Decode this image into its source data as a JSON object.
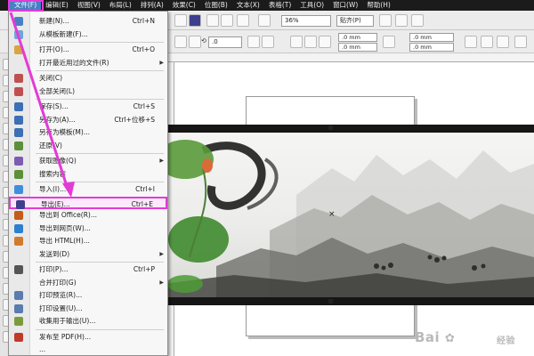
{
  "menubar": {
    "items": [
      {
        "label": "文件(F)",
        "active": true
      },
      {
        "label": "编辑(E)"
      },
      {
        "label": "视图(V)"
      },
      {
        "label": "布局(L)"
      },
      {
        "label": "排列(A)"
      },
      {
        "label": "效果(C)"
      },
      {
        "label": "位图(B)"
      },
      {
        "label": "文本(X)"
      },
      {
        "label": "表格(T)"
      },
      {
        "label": "工具(O)"
      },
      {
        "label": "窗口(W)"
      },
      {
        "label": "帮助(H)"
      }
    ]
  },
  "toolbar1": {
    "zoom_value": "36%",
    "snap_label": "贴齐(P)"
  },
  "toolbar2": {
    "rotation_value": ".0",
    "x_offset": ".0 mm",
    "y_offset": ".0 mm",
    "dup_x": ".0 mm",
    "dup_y": ".0 mm"
  },
  "file_menu": {
    "items": [
      {
        "label": "新建(N)...",
        "shortcut": "Ctrl+N",
        "icon": "new-doc-icon"
      },
      {
        "label": "从模板新建(F)...",
        "shortcut": "",
        "icon": "template-icon"
      },
      {
        "label": "打开(O)...",
        "shortcut": "Ctrl+O",
        "icon": "open-folder-icon"
      },
      {
        "label": "打开最近用过的文件(R)",
        "shortcut": "",
        "icon": "",
        "submenu": true
      },
      {
        "label": "关闭(C)",
        "shortcut": "",
        "icon": "close-doc-icon"
      },
      {
        "label": "全部关闭(L)",
        "shortcut": "",
        "icon": "close-all-icon"
      },
      {
        "label": "保存(S)...",
        "shortcut": "Ctrl+S",
        "icon": "save-icon"
      },
      {
        "label": "另存为(A)...",
        "shortcut": "Ctrl+位移+S",
        "icon": "save-as-icon"
      },
      {
        "label": "另存为模板(M)...",
        "shortcut": "",
        "icon": "save-template-icon"
      },
      {
        "label": "还原(V)",
        "shortcut": "",
        "icon": "revert-icon"
      },
      {
        "label": "获取图像(Q)",
        "shortcut": "",
        "icon": "acquire-image-icon",
        "submenu": true
      },
      {
        "label": "搜索内容",
        "shortcut": "",
        "icon": "search-content-icon"
      },
      {
        "label": "导入(I)...",
        "shortcut": "Ctrl+I",
        "icon": "import-icon"
      },
      {
        "label": "导出(E)...",
        "shortcut": "Ctrl+E",
        "icon": "export-icon",
        "highlight": true
      },
      {
        "label": "导出到 Office(R)...",
        "shortcut": "",
        "icon": "export-office-icon"
      },
      {
        "label": "导出到网页(W)...",
        "shortcut": "",
        "icon": "export-web-icon"
      },
      {
        "label": "导出 HTML(H)...",
        "shortcut": "",
        "icon": "export-html-icon"
      },
      {
        "label": "发送到(D)",
        "shortcut": "",
        "icon": "",
        "submenu": true
      },
      {
        "label": "打印(P)...",
        "shortcut": "Ctrl+P",
        "icon": "print-icon"
      },
      {
        "label": "合并打印(G)",
        "shortcut": "",
        "icon": "",
        "submenu": true
      },
      {
        "label": "打印预览(R)...",
        "shortcut": "",
        "icon": "print-preview-icon"
      },
      {
        "label": "打印设置(U)...",
        "shortcut": "",
        "icon": "print-setup-icon"
      },
      {
        "label": "收集用于输出(U)...",
        "shortcut": "",
        "icon": "collect-output-icon"
      },
      {
        "label": "发布至 PDF(H)...",
        "shortcut": "",
        "icon": "pdf-icon"
      },
      {
        "label": "...",
        "shortcut": "",
        "icon": ""
      }
    ]
  },
  "watermark": {
    "text": "Bai",
    "brand": "经验"
  },
  "colors": {
    "menubar_bg": "#1b1b1b",
    "active_menu": "#4a7fc5",
    "highlight": "#e33bd6"
  }
}
